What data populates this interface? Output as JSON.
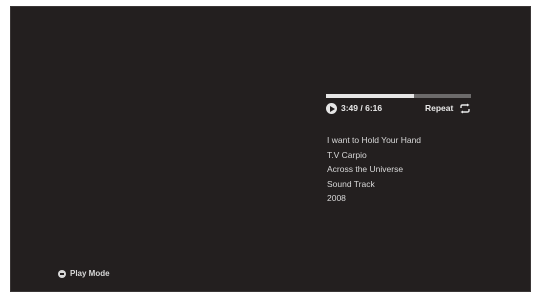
{
  "player": {
    "progress_fraction": 0.61,
    "elapsed": "3:49",
    "total": "6:16",
    "time_display": "3:49 / 6:16",
    "repeat_label": "Repeat",
    "colors": {
      "background": "#231f1f",
      "text": "#e8e8e8",
      "progress_track": "#6c6a6a",
      "progress_fill": "#e6e6e6"
    }
  },
  "track": {
    "title": "I want to Hold Your Hand",
    "artist": "T.V Carpio",
    "album": "Across the Universe",
    "genre": "Sound Track",
    "year": "2008"
  },
  "footer": {
    "play_mode_label": "Play Mode",
    "play_mode_icon": "play-mode-button-icon"
  }
}
